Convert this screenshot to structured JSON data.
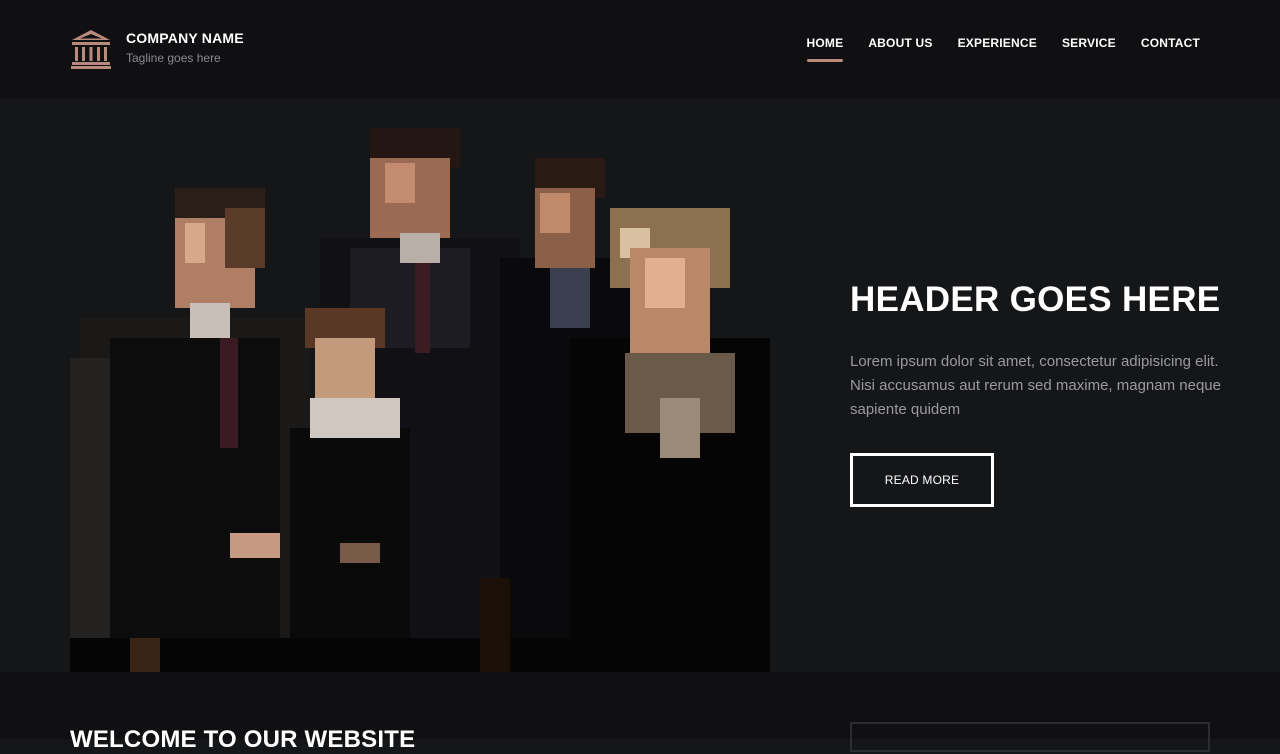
{
  "brand": {
    "company_name": "COMPANY NAME",
    "tagline": "Tagline goes here",
    "icon": "bank-building-icon",
    "icon_color": "#b9897c"
  },
  "nav": {
    "items": [
      {
        "label": "HOME",
        "active": true
      },
      {
        "label": "ABOUT US",
        "active": false
      },
      {
        "label": "EXPERIENCE",
        "active": false
      },
      {
        "label": "SERVICE",
        "active": false
      },
      {
        "label": "CONTACT",
        "active": false
      }
    ],
    "active_color": "#b9897c"
  },
  "hero": {
    "title": "HEADER GOES HERE",
    "text": "Lorem ipsum dolor sit amet, consectetur adipisicing elit. Nisi accusamus aut rerum sed maxime, magnam neque sapiente quidem",
    "button_label": "READ MORE"
  },
  "welcome": {
    "title": "WELCOME TO OUR WEBSITE"
  }
}
